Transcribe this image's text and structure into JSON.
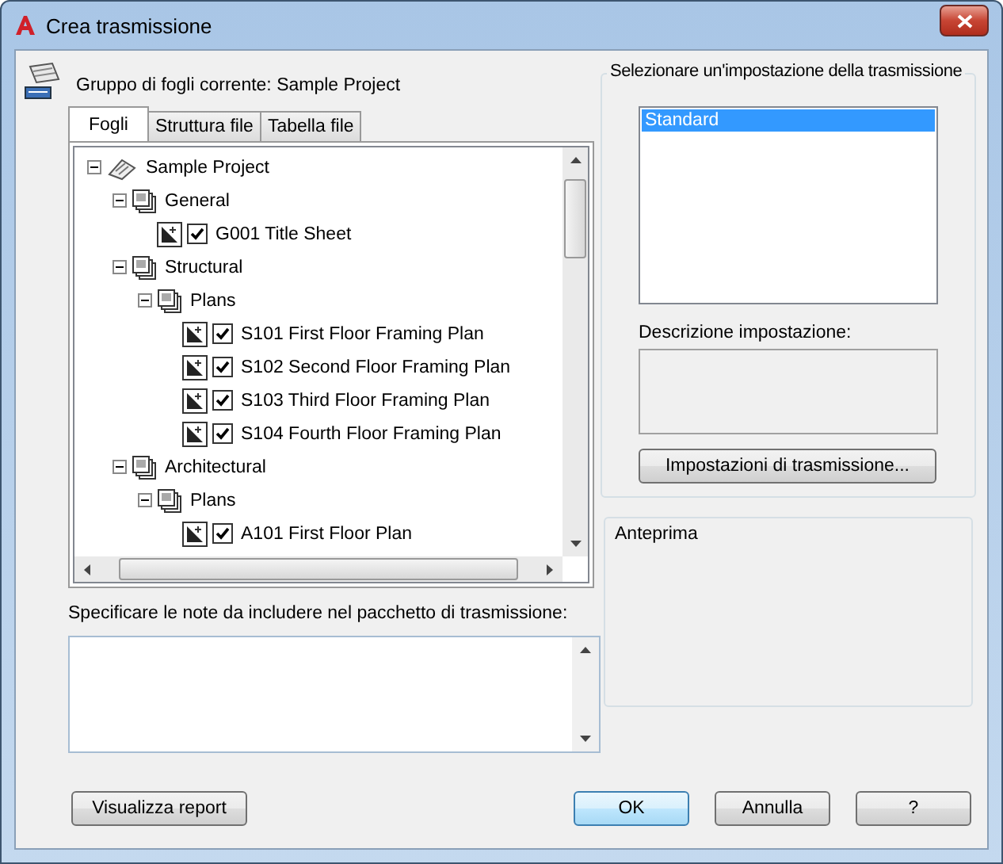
{
  "window": {
    "title": "Crea trasmissione"
  },
  "sheet_set": {
    "label": "Gruppo di fogli corrente: Sample Project"
  },
  "tabs": [
    {
      "label": "Fogli",
      "selected": true
    },
    {
      "label": "Struttura file",
      "selected": false
    },
    {
      "label": "Tabella file",
      "selected": false
    }
  ],
  "tree": {
    "items": [
      {
        "kind": "project",
        "label": "Sample Project",
        "expanded": true,
        "children": [
          {
            "kind": "subset",
            "label": "General",
            "expanded": true,
            "children": [
              {
                "kind": "sheet",
                "label": "G001 Title Sheet",
                "checked": true
              }
            ]
          },
          {
            "kind": "subset",
            "label": "Structural",
            "expanded": true,
            "children": [
              {
                "kind": "subset",
                "label": "Plans",
                "expanded": true,
                "children": [
                  {
                    "kind": "sheet",
                    "label": "S101 First Floor Framing Plan",
                    "checked": true
                  },
                  {
                    "kind": "sheet",
                    "label": "S102 Second Floor Framing Plan",
                    "checked": true
                  },
                  {
                    "kind": "sheet",
                    "label": "S103 Third Floor Framing Plan",
                    "checked": true
                  },
                  {
                    "kind": "sheet",
                    "label": "S104 Fourth Floor Framing Plan",
                    "checked": true
                  }
                ]
              }
            ]
          },
          {
            "kind": "subset",
            "label": "Architectural",
            "expanded": true,
            "children": [
              {
                "kind": "subset",
                "label": "Plans",
                "expanded": true,
                "children": [
                  {
                    "kind": "sheet",
                    "label": "A101 First Floor Plan",
                    "checked": true
                  }
                ]
              }
            ]
          }
        ]
      }
    ]
  },
  "notes": {
    "label": "Specificare le note da includere nel pacchetto di trasmissione:"
  },
  "setups": {
    "title": "Selezionare un'impostazione della trasmissione",
    "items": [
      {
        "label": "Standard",
        "selected": true
      }
    ],
    "description_label": "Descrizione impostazione:",
    "button": "Impostazioni di trasmissione..."
  },
  "preview": {
    "title": "Anteprima"
  },
  "buttons": [
    {
      "label": "Visualizza report",
      "default": false
    },
    {
      "label": "OK",
      "default": true
    },
    {
      "label": "Annulla",
      "default": false
    },
    {
      "label": "?",
      "default": false
    }
  ]
}
